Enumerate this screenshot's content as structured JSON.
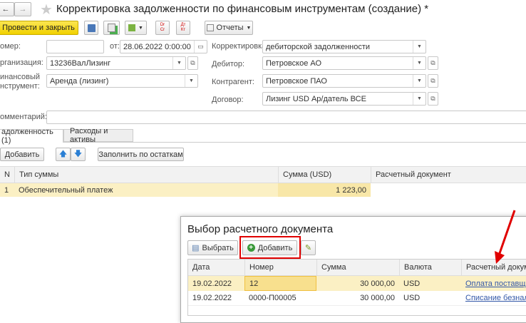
{
  "header": {
    "title": "Корректировка задолженности по финансовым инструментам (создание) *"
  },
  "toolbar": {
    "post_close": "Провести и закрыть",
    "reports": "Отчеты",
    "dt_label": "Dr",
    "ct_label": "Cr",
    "dt_ru": "Дт",
    "kt_ru": "Кт"
  },
  "form": {
    "number_label": "омер:",
    "number_value": "",
    "date_label": "от:",
    "date_value": "28.06.2022  0:00:00",
    "org_label": "рганизация:",
    "org_value": "13236ВалЛизинг",
    "instrument_label_1": "инансовый",
    "instrument_label_2": "нструмент:",
    "instrument_value": "Аренда (лизинг)",
    "correction_label": "Корректировка:",
    "correction_value": "дебиторской задолженности",
    "debtor_label": "Дебитор:",
    "debtor_value": "Петровское АО",
    "counterparty_label": "Контрагент:",
    "counterparty_value": "Петровское ПАО",
    "contract_label": "Договор:",
    "contract_value": "Лизинг USD Ар/датель ВСЕ",
    "comment_label": "омментарий:",
    "comment_value": ""
  },
  "tabs": [
    {
      "label": "адолженность (1)"
    },
    {
      "label": "Расходы и активы"
    }
  ],
  "debt_toolbar": {
    "add": "Добавить",
    "fill": "Заполнить по остаткам"
  },
  "debt_table": {
    "headers": [
      "N",
      "Тип суммы",
      "Сумма (USD)",
      "Расчетный документ"
    ],
    "rows": [
      [
        "1",
        "Обеспечительный платеж",
        "1 223,00",
        ""
      ]
    ]
  },
  "dialog": {
    "title": "Выбор расчетного документа",
    "select": "Выбрать",
    "add": "Добавить",
    "headers": [
      "Дата",
      "Номер",
      "Сумма",
      "Валюта",
      "Расчетный докуме"
    ],
    "rows": [
      [
        "19.02.2022",
        "12",
        "30 000,00",
        "USD",
        "Оплата поставщику"
      ],
      [
        "19.02.2022",
        "0000-П00005",
        "30 000,00",
        "USD",
        "Списание безнали"
      ]
    ]
  },
  "colors": {
    "accent": "#f5d600",
    "highlight": "#fbf0c4",
    "annotation": "#e00000",
    "link": "#3358a8"
  }
}
